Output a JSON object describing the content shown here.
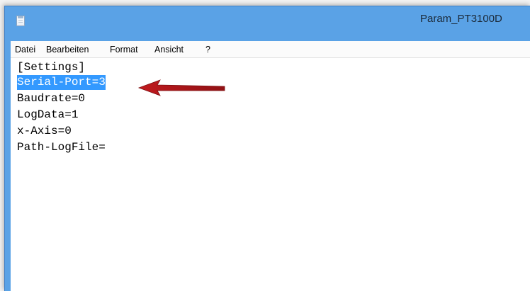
{
  "window": {
    "title": "Param_PT3100D"
  },
  "menu": {
    "items": [
      "Datei",
      "Bearbeiten",
      "Format",
      "Ansicht",
      "?"
    ]
  },
  "editor": {
    "lines": [
      "[Settings]",
      "Serial-Port=3",
      "Baudrate=0",
      "LogData=1",
      "x-Axis=0",
      "Path-LogFile="
    ],
    "selected_line": 1
  },
  "colors": {
    "titlebar": "#5aa2e6",
    "selection": "#3399ff",
    "annotation_arrow": "#c0161a"
  },
  "icons": {
    "app": "notepad-icon",
    "annotation": "red-arrow-annotation"
  }
}
